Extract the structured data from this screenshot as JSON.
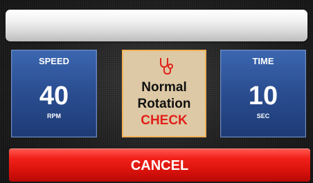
{
  "speed": {
    "label": "SPEED",
    "value": "40",
    "unit": "RPM"
  },
  "time": {
    "label": "TIME",
    "value": "10",
    "unit": "SEC"
  },
  "status": {
    "icon": "stethoscope-icon",
    "line1": "Normal",
    "line2": "Rotation",
    "check": "CHECK"
  },
  "cancel_button": {
    "label": "CANCEL"
  },
  "colors": {
    "panel_blue": "#2c4f93",
    "status_bg": "#ddc9a5",
    "status_border": "#f1b15a",
    "check_red": "#e2201a",
    "cancel_red": "#d7110b"
  }
}
